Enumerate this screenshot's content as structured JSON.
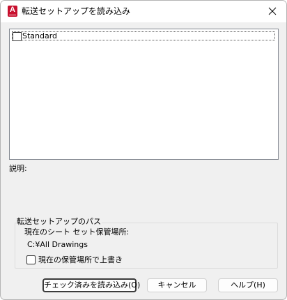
{
  "window": {
    "title": "転送セットアップを読み込み"
  },
  "setups": [
    {
      "label": "Standard",
      "checked": false
    }
  ],
  "description_label": "説明:",
  "path_group": {
    "title": "転送セットアップのパス",
    "location_label": "現在のシート セット保管場所:",
    "path_value": "C:¥All Drawings",
    "overwrite_label": "現在の保管場所で上書き",
    "overwrite_checked": false
  },
  "buttons": {
    "load_checked": "チェック済みを読み込み(O)",
    "cancel": "キャンセル",
    "help": "ヘルプ(H)"
  },
  "icons": {
    "app": "autocad-app-icon",
    "close": "close-icon"
  },
  "colors": {
    "app_icon": "#c8102e",
    "dialog_bg": "#f0f0f0"
  }
}
